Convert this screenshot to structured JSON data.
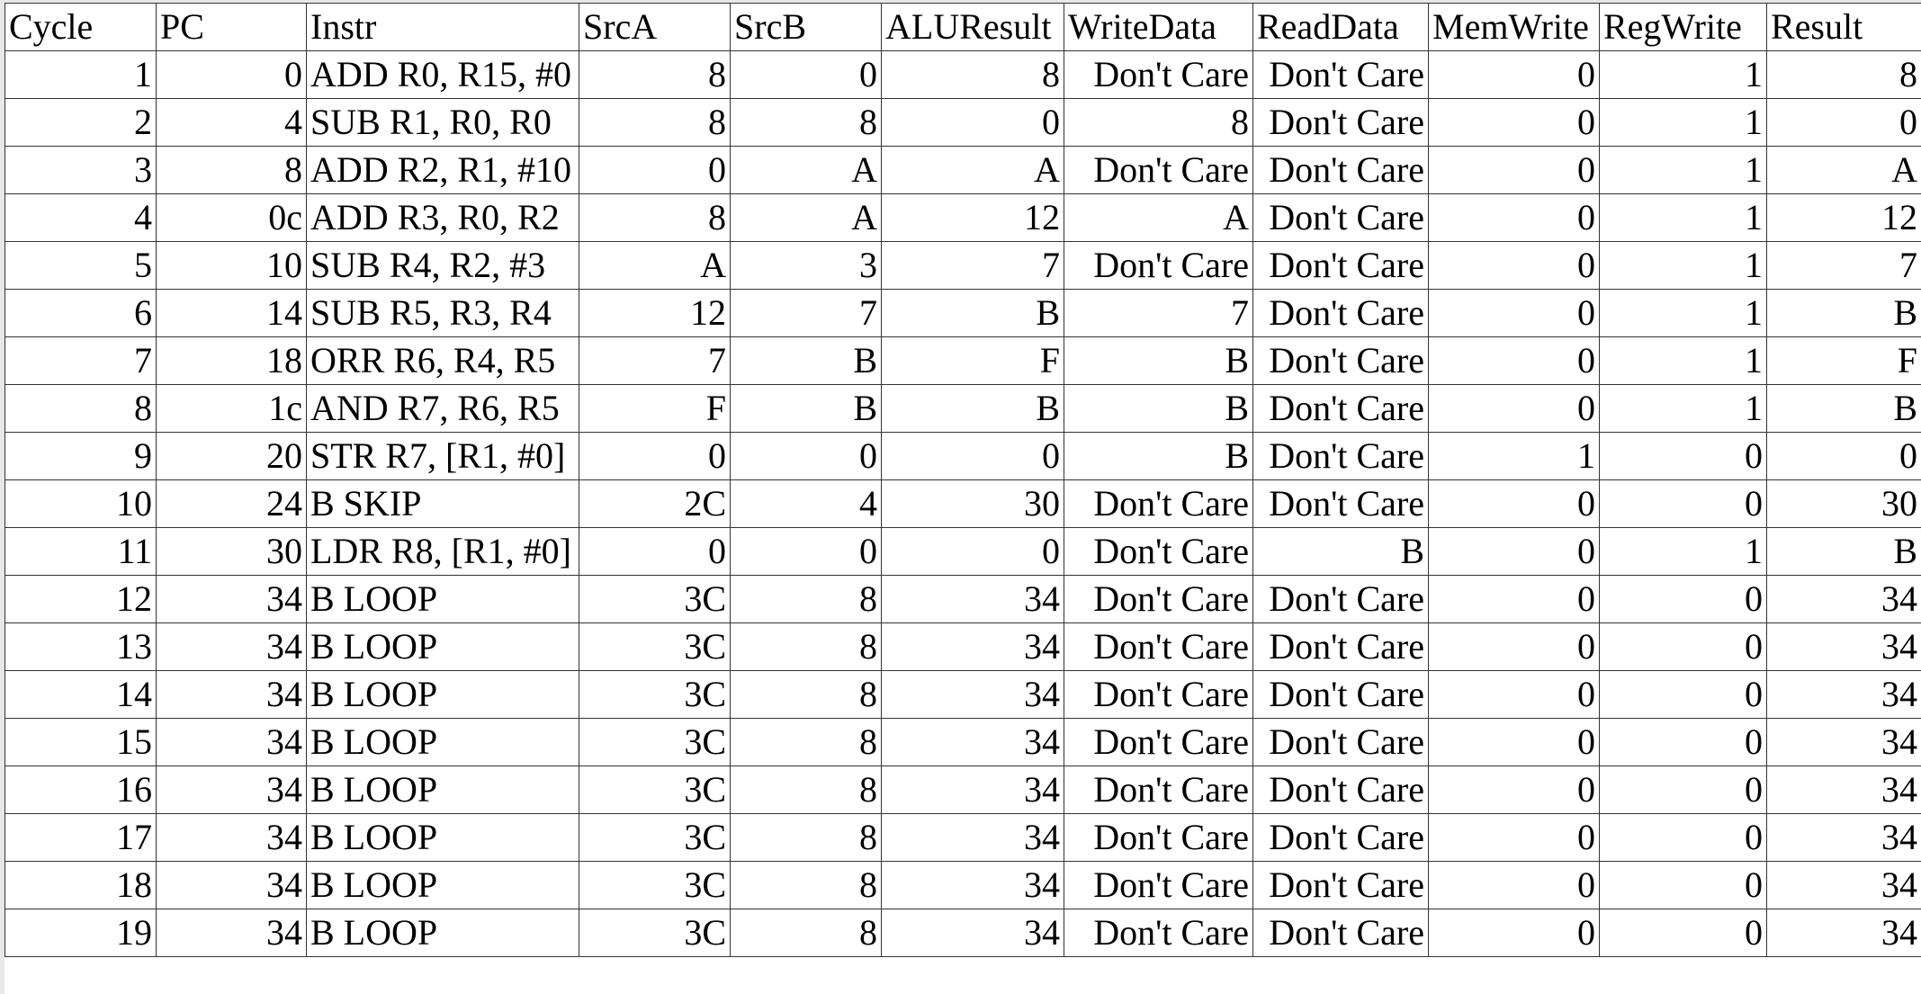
{
  "table": {
    "headers": [
      "Cycle",
      "PC",
      "Instr",
      "SrcA",
      "SrcB",
      "ALUResult",
      "WriteData",
      "ReadData",
      "MemWrite",
      "RegWrite",
      "Result"
    ],
    "rows": [
      [
        "1",
        "0",
        "ADD R0, R15, #0",
        "8",
        "0",
        "8",
        "Don't Care",
        "Don't Care",
        "0",
        "1",
        "8"
      ],
      [
        "2",
        "4",
        "SUB R1, R0, R0",
        "8",
        "8",
        "0",
        "8",
        "Don't Care",
        "0",
        "1",
        "0"
      ],
      [
        "3",
        "8",
        "ADD R2, R1, #10",
        "0",
        "A",
        "A",
        "Don't Care",
        "Don't Care",
        "0",
        "1",
        "A"
      ],
      [
        "4",
        "0c",
        "ADD R3, R0, R2",
        "8",
        "A",
        "12",
        "A",
        "Don't Care",
        "0",
        "1",
        "12"
      ],
      [
        "5",
        "10",
        "SUB R4, R2, #3",
        "A",
        "3",
        "7",
        "Don't Care",
        "Don't Care",
        "0",
        "1",
        "7"
      ],
      [
        "6",
        "14",
        "SUB R5, R3, R4",
        "12",
        "7",
        "B",
        "7",
        "Don't Care",
        "0",
        "1",
        "B"
      ],
      [
        "7",
        "18",
        "ORR R6, R4, R5",
        "7",
        "B",
        "F",
        "B",
        "Don't Care",
        "0",
        "1",
        "F"
      ],
      [
        "8",
        "1c",
        "AND R7, R6, R5",
        "F",
        "B",
        "B",
        "B",
        "Don't Care",
        "0",
        "1",
        "B"
      ],
      [
        "9",
        "20",
        "STR R7, [R1, #0]",
        "0",
        "0",
        "0",
        "B",
        "Don't Care",
        "1",
        "0",
        "0"
      ],
      [
        "10",
        "24",
        "B SKIP",
        "2C",
        "4",
        "30",
        "Don't Care",
        "Don't Care",
        "0",
        "0",
        "30"
      ],
      [
        "11",
        "30",
        "LDR R8, [R1, #0]",
        "0",
        "0",
        "0",
        "Don't Care",
        "B",
        "0",
        "1",
        "B"
      ],
      [
        "12",
        "34",
        "B LOOP",
        "3C",
        "8",
        "34",
        "Don't Care",
        "Don't Care",
        "0",
        "0",
        "34"
      ],
      [
        "13",
        "34",
        "B LOOP",
        "3C",
        "8",
        "34",
        "Don't Care",
        "Don't Care",
        "0",
        "0",
        "34"
      ],
      [
        "14",
        "34",
        "B LOOP",
        "3C",
        "8",
        "34",
        "Don't Care",
        "Don't Care",
        "0",
        "0",
        "34"
      ],
      [
        "15",
        "34",
        "B LOOP",
        "3C",
        "8",
        "34",
        "Don't Care",
        "Don't Care",
        "0",
        "0",
        "34"
      ],
      [
        "16",
        "34",
        "B LOOP",
        "3C",
        "8",
        "34",
        "Don't Care",
        "Don't Care",
        "0",
        "0",
        "34"
      ],
      [
        "17",
        "34",
        "B LOOP",
        "3C",
        "8",
        "34",
        "Don't Care",
        "Don't Care",
        "0",
        "0",
        "34"
      ],
      [
        "18",
        "34",
        "B LOOP",
        "3C",
        "8",
        "34",
        "Don't Care",
        "Don't Care",
        "0",
        "0",
        "34"
      ],
      [
        "19",
        "34",
        "B LOOP",
        "3C",
        "8",
        "34",
        "Don't Care",
        "Don't Care",
        "0",
        "0",
        "34"
      ]
    ]
  }
}
